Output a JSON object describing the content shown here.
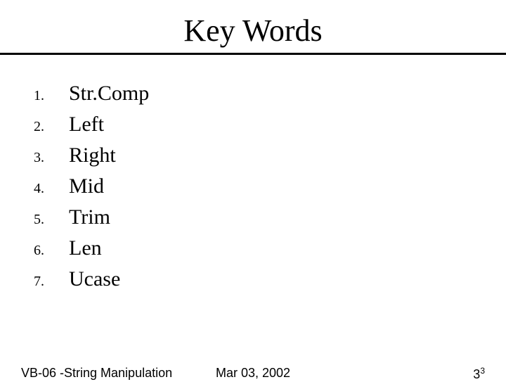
{
  "title": "Key Words",
  "items": [
    {
      "num": "1.",
      "term": "Str.Comp"
    },
    {
      "num": "2.",
      "term": "Left"
    },
    {
      "num": "3.",
      "term": "Right"
    },
    {
      "num": "4.",
      "term": "Mid"
    },
    {
      "num": "5.",
      "term": "Trim"
    },
    {
      "num": "6.",
      "term": "Len"
    },
    {
      "num": "7.",
      "term": "Ucase"
    }
  ],
  "footer": {
    "left": "VB-06 -String Manipulation",
    "center": "Mar 03, 2002",
    "right_main": "3",
    "right_sup": "3"
  }
}
